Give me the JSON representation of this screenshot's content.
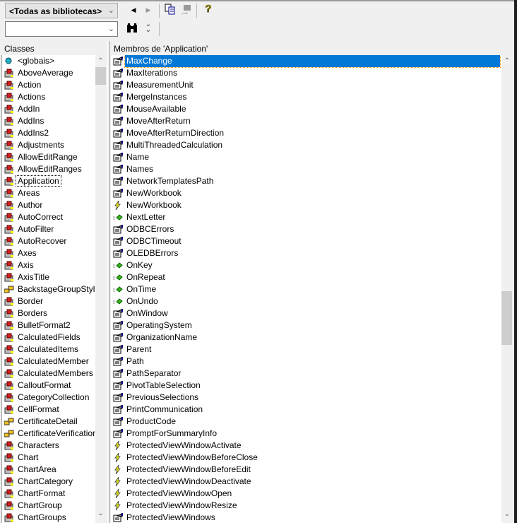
{
  "toolbar": {
    "library_select": "<Todas as bibliotecas>",
    "search_value": "",
    "icons": [
      "back-icon",
      "forward-icon",
      "copy-icon",
      "view-definition-icon",
      "help-icon",
      "search-binoculars-icon",
      "toggle-results-icon"
    ]
  },
  "classes": {
    "header": "Classes",
    "focused": "Application",
    "items": [
      {
        "label": "<globais>",
        "kind": "module"
      },
      {
        "label": "AboveAverage",
        "kind": "class"
      },
      {
        "label": "Action",
        "kind": "class"
      },
      {
        "label": "Actions",
        "kind": "class"
      },
      {
        "label": "AddIn",
        "kind": "class"
      },
      {
        "label": "AddIns",
        "kind": "class"
      },
      {
        "label": "AddIns2",
        "kind": "class"
      },
      {
        "label": "Adjustments",
        "kind": "class"
      },
      {
        "label": "AllowEditRange",
        "kind": "class"
      },
      {
        "label": "AllowEditRanges",
        "kind": "class"
      },
      {
        "label": "Application",
        "kind": "class"
      },
      {
        "label": "Areas",
        "kind": "class"
      },
      {
        "label": "Author",
        "kind": "class"
      },
      {
        "label": "AutoCorrect",
        "kind": "class"
      },
      {
        "label": "AutoFilter",
        "kind": "class"
      },
      {
        "label": "AutoRecover",
        "kind": "class"
      },
      {
        "label": "Axes",
        "kind": "class"
      },
      {
        "label": "Axis",
        "kind": "class"
      },
      {
        "label": "AxisTitle",
        "kind": "class"
      },
      {
        "label": "BackstageGroupStyl",
        "kind": "enum"
      },
      {
        "label": "Border",
        "kind": "class"
      },
      {
        "label": "Borders",
        "kind": "class"
      },
      {
        "label": "BulletFormat2",
        "kind": "class"
      },
      {
        "label": "CalculatedFields",
        "kind": "class"
      },
      {
        "label": "CalculatedItems",
        "kind": "class"
      },
      {
        "label": "CalculatedMember",
        "kind": "class"
      },
      {
        "label": "CalculatedMembers",
        "kind": "class"
      },
      {
        "label": "CalloutFormat",
        "kind": "class"
      },
      {
        "label": "CategoryCollection",
        "kind": "class"
      },
      {
        "label": "CellFormat",
        "kind": "class"
      },
      {
        "label": "CertificateDetail",
        "kind": "enum"
      },
      {
        "label": "CertificateVerification",
        "kind": "enum"
      },
      {
        "label": "Characters",
        "kind": "class"
      },
      {
        "label": "Chart",
        "kind": "class"
      },
      {
        "label": "ChartArea",
        "kind": "class"
      },
      {
        "label": "ChartCategory",
        "kind": "class"
      },
      {
        "label": "ChartFormat",
        "kind": "class"
      },
      {
        "label": "ChartGroup",
        "kind": "class"
      },
      {
        "label": "ChartGroups",
        "kind": "class"
      }
    ]
  },
  "members": {
    "header": "Membros de 'Application'",
    "selected": "MaxChange",
    "items": [
      {
        "label": "MaxChange",
        "kind": "property"
      },
      {
        "label": "MaxIterations",
        "kind": "property"
      },
      {
        "label": "MeasurementUnit",
        "kind": "property"
      },
      {
        "label": "MergeInstances",
        "kind": "property"
      },
      {
        "label": "MouseAvailable",
        "kind": "property"
      },
      {
        "label": "MoveAfterReturn",
        "kind": "property"
      },
      {
        "label": "MoveAfterReturnDirection",
        "kind": "property"
      },
      {
        "label": "MultiThreadedCalculation",
        "kind": "property"
      },
      {
        "label": "Name",
        "kind": "property"
      },
      {
        "label": "Names",
        "kind": "property"
      },
      {
        "label": "NetworkTemplatesPath",
        "kind": "property"
      },
      {
        "label": "NewWorkbook",
        "kind": "property"
      },
      {
        "label": "NewWorkbook",
        "kind": "event"
      },
      {
        "label": "NextLetter",
        "kind": "method"
      },
      {
        "label": "ODBCErrors",
        "kind": "property"
      },
      {
        "label": "ODBCTimeout",
        "kind": "property"
      },
      {
        "label": "OLEDBErrors",
        "kind": "property"
      },
      {
        "label": "OnKey",
        "kind": "method"
      },
      {
        "label": "OnRepeat",
        "kind": "method"
      },
      {
        "label": "OnTime",
        "kind": "method"
      },
      {
        "label": "OnUndo",
        "kind": "method"
      },
      {
        "label": "OnWindow",
        "kind": "property"
      },
      {
        "label": "OperatingSystem",
        "kind": "property"
      },
      {
        "label": "OrganizationName",
        "kind": "property"
      },
      {
        "label": "Parent",
        "kind": "property"
      },
      {
        "label": "Path",
        "kind": "property"
      },
      {
        "label": "PathSeparator",
        "kind": "property"
      },
      {
        "label": "PivotTableSelection",
        "kind": "property"
      },
      {
        "label": "PreviousSelections",
        "kind": "property"
      },
      {
        "label": "PrintCommunication",
        "kind": "property"
      },
      {
        "label": "ProductCode",
        "kind": "property"
      },
      {
        "label": "PromptForSummaryInfo",
        "kind": "property"
      },
      {
        "label": "ProtectedViewWindowActivate",
        "kind": "event"
      },
      {
        "label": "ProtectedViewWindowBeforeClose",
        "kind": "event"
      },
      {
        "label": "ProtectedViewWindowBeforeEdit",
        "kind": "event"
      },
      {
        "label": "ProtectedViewWindowDeactivate",
        "kind": "event"
      },
      {
        "label": "ProtectedViewWindowOpen",
        "kind": "event"
      },
      {
        "label": "ProtectedViewWindowResize",
        "kind": "event"
      },
      {
        "label": "ProtectedViewWindows",
        "kind": "property"
      }
    ]
  }
}
